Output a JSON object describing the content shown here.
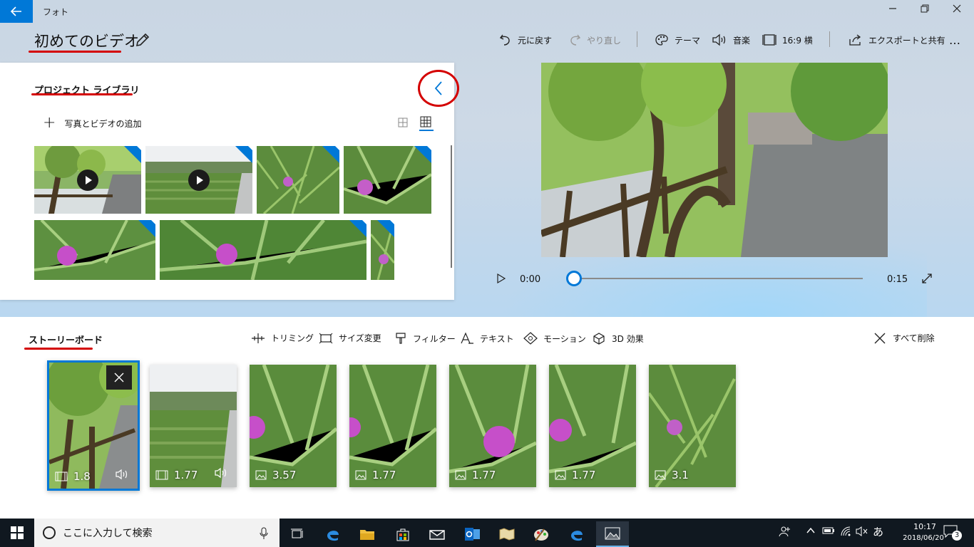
{
  "window": {
    "app_title": "フォト"
  },
  "project": {
    "title": "初めてのビデオ"
  },
  "toolbar": {
    "undo": "元に戻す",
    "redo": "やり直し",
    "theme": "テーマ",
    "music": "音楽",
    "aspect": "16:9 横",
    "export": "エクスポートと共有",
    "more": "…"
  },
  "library": {
    "title": "プロジェクト ライブラリ",
    "add_media": "写真とビデオの追加",
    "thumbnails": [
      {
        "kind": "video",
        "scene": "path"
      },
      {
        "kind": "video",
        "scene": "field"
      },
      {
        "kind": "photo",
        "scene": "thistle-small"
      },
      {
        "kind": "photo",
        "scene": "thistle"
      },
      {
        "kind": "photo",
        "scene": "thistle-close"
      },
      {
        "kind": "photo",
        "scene": "thistle-wide"
      },
      {
        "kind": "photo",
        "scene": "thistle-narrow"
      }
    ]
  },
  "player": {
    "current_time": "0:00",
    "total_time": "0:15",
    "progress": 0.0
  },
  "storyboard": {
    "title": "ストーリーボード",
    "tools": {
      "trim": "トリミング",
      "resize": "サイズ変更",
      "filter": "フィルター",
      "text": "テキスト",
      "motion": "モーション",
      "effects3d": "3D 効果"
    },
    "delete_all": "すべて削除",
    "cards": [
      {
        "kind": "video",
        "duration": "1.8",
        "audio": true
      },
      {
        "kind": "video",
        "duration": "1.77",
        "audio": true
      },
      {
        "kind": "photo",
        "duration": "3.57",
        "audio": false
      },
      {
        "kind": "photo",
        "duration": "1.77",
        "audio": false
      },
      {
        "kind": "photo",
        "duration": "1.77",
        "audio": false
      },
      {
        "kind": "photo",
        "duration": "1.77",
        "audio": false
      },
      {
        "kind": "photo",
        "duration": "3.1",
        "audio": false
      }
    ]
  },
  "taskbar": {
    "search_placeholder": "ここに入力して検索",
    "time": "10:17",
    "date": "2018/06/20",
    "ime": "あ",
    "notifications": "3"
  },
  "colors": {
    "accent": "#0078d7",
    "annotation": "#d40000"
  }
}
